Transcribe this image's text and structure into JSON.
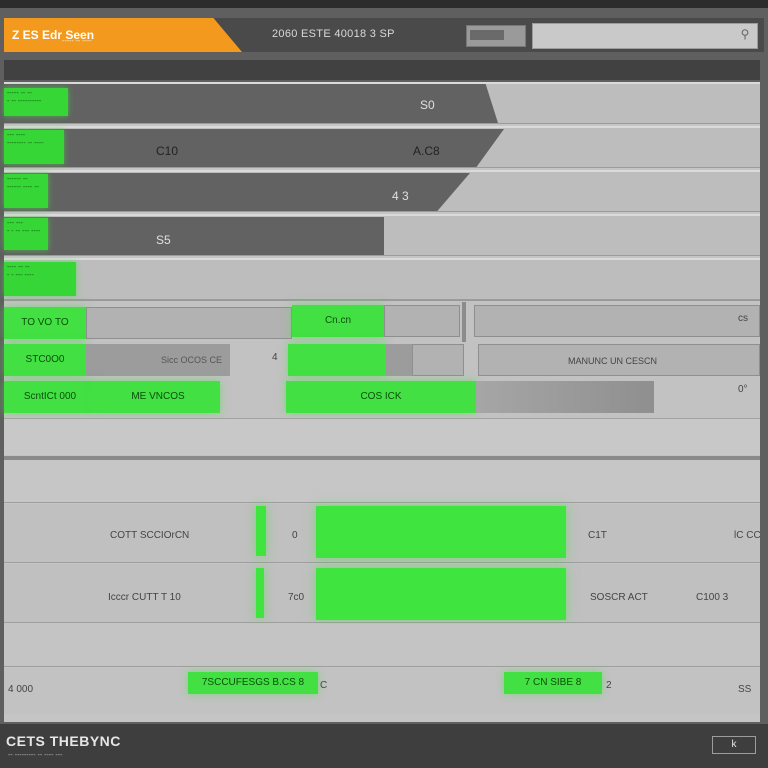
{
  "window": {
    "brand": "Z ES Edr Seen",
    "brand_sub": "----- -- ----",
    "title": "2060 ESTE 40018 3 SP",
    "search_placeholder": ""
  },
  "rows": [
    {
      "value": "S0",
      "tag": [
        "----- -- --",
        "- -- ----------"
      ]
    },
    {
      "value_left": "C10",
      "value": "A.C8",
      "tag": [
        "--- ----",
        "-------- -- ----"
      ]
    },
    {
      "value": "4 3",
      "tag": [
        "------ --",
        "------ ---- --"
      ]
    },
    {
      "value": "S5",
      "tag": [
        "--- ---",
        "- - -- --- ----"
      ]
    },
    {
      "value": "",
      "tag": [
        "---- -- --",
        "- - --- ----"
      ]
    }
  ],
  "controls": {
    "r1_btn": "TO VO TO",
    "r1_center": "Cn.cn",
    "r1_right": "cs",
    "r2_btn": "STC0O0",
    "r2_gray": "Sicc OCOS CE",
    "r2_mid": "4",
    "r2_right": "MANUNC UN CESCN",
    "r3_btn": "ScntICt 000",
    "r3_btn2": "ME VNCOS",
    "r3_center": "COS ICK",
    "r3_right": "0°"
  },
  "bars": [
    {
      "label": "COTT SCCIOrCN",
      "val": "0",
      "right": "C1T",
      "far": "lC CC"
    },
    {
      "label": "Icccr CUTT T 10",
      "val": "7c0",
      "right": "SOSCR ACT",
      "far": "C100 3"
    }
  ],
  "bottom_row": {
    "left": "4 000",
    "btn1": "7SCCUFESGS B.CS 8",
    "btn1_tail": "C",
    "btn2": "7 CN SIBE 8",
    "btn2_tail": "2",
    "right": "SS"
  },
  "footer": {
    "title": "CETS THEBYNC",
    "sub": "-- --------- -- ---- ---",
    "button": "k"
  },
  "colors": {
    "accent_orange": "#f39a1e",
    "accent_green": "#3fe43f",
    "chrome": "#4a4a4a"
  }
}
